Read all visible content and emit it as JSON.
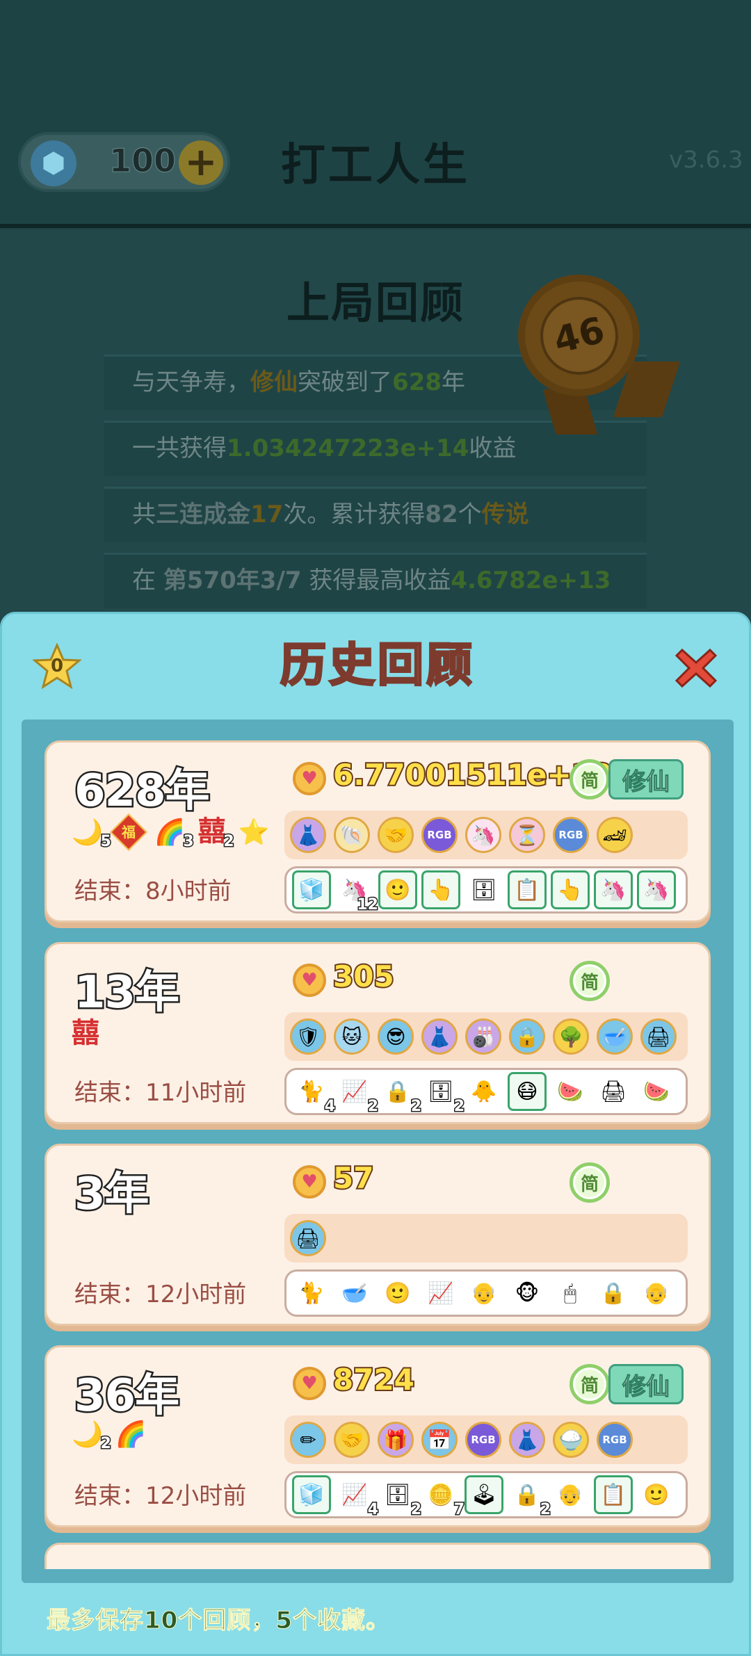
{
  "header": {
    "gems": "100",
    "title": "打工人生",
    "version": "v3.6.3"
  },
  "last_game": {
    "title": "上局回顾",
    "medal_number": "46",
    "lines": [
      {
        "parts": [
          "与天争寿，",
          "修仙",
          "突破到了",
          "628",
          "年"
        ]
      },
      {
        "parts": [
          "一共获得",
          "1.034247223e+14",
          "收益"
        ]
      },
      {
        "parts": [
          "共",
          "三连成金",
          "17",
          "次。累计获得",
          "82",
          "个",
          "传说"
        ]
      },
      {
        "parts": [
          "在 ",
          "第570年3/7",
          " 获得最高收益",
          "4.6782e+13"
        ]
      }
    ]
  },
  "dialog": {
    "title": "历史回顾",
    "star_count": "0",
    "footer_note": "最多保存10个回顾，5个收藏。",
    "simple_label": "简",
    "xiuxian_label": "修仙",
    "end_prefix": "结束：",
    "cards": [
      {
        "year": "628年",
        "score": "6.77001511e+13",
        "end_time": "8小时前",
        "xiuxian": true,
        "badges": [
          {
            "icon": "moon-icon",
            "glyph": "🌙",
            "count": "5"
          },
          {
            "icon": "fu-icon",
            "glyph": "福",
            "count": ""
          },
          {
            "icon": "rainbow-icon",
            "glyph": "🌈",
            "count": "3"
          },
          {
            "icon": "double-happiness-icon",
            "glyph": "囍",
            "count": "2"
          },
          {
            "icon": "star-icon",
            "glyph": "⭐",
            "count": ""
          }
        ],
        "row1": [
          {
            "icon": "skirt-icon",
            "glyph": "👗",
            "bg": "#c9a6e8"
          },
          {
            "icon": "shell-icon",
            "glyph": "🐚",
            "bg": "#f8e6a8"
          },
          {
            "icon": "handshake-icon",
            "glyph": "🤝",
            "bg": "#f6d24a"
          },
          {
            "icon": "rgb-icon",
            "glyph": "RGB",
            "bg": "#7a5ad8"
          },
          {
            "icon": "unicorn-icon",
            "glyph": "🦄",
            "bg": "#fbe4f0"
          },
          {
            "icon": "time-icon",
            "glyph": "⏳",
            "bg": "#f5c9d8"
          },
          {
            "icon": "rgb-icon",
            "glyph": "RGB",
            "bg": "#5a8ad8"
          },
          {
            "icon": "car-icon",
            "glyph": "🏎",
            "bg": "#f6d24a"
          }
        ],
        "row2": [
          {
            "icon": "fridge-icon",
            "glyph": "🧊",
            "count": "",
            "framed": true
          },
          {
            "icon": "unicorn-icon",
            "glyph": "🦄",
            "count": "12",
            "framed": false
          },
          {
            "icon": "face-icon",
            "glyph": "🙂",
            "count": "",
            "framed": true
          },
          {
            "icon": "pointer-icon",
            "glyph": "👆",
            "count": "",
            "framed": true
          },
          {
            "icon": "server-icon",
            "glyph": "🗄",
            "count": "",
            "framed": false
          },
          {
            "icon": "ctrl-c-icon",
            "glyph": "📋",
            "count": "",
            "framed": true
          },
          {
            "icon": "pointer-icon",
            "glyph": "👆",
            "count": "",
            "framed": true
          },
          {
            "icon": "unicorn-icon",
            "glyph": "🦄",
            "count": "",
            "framed": true
          },
          {
            "icon": "unicorn-icon",
            "glyph": "🦄",
            "count": "",
            "framed": true
          }
        ]
      },
      {
        "year": "13年",
        "score": "305",
        "end_time": "11小时前",
        "xiuxian": false,
        "badges": [
          {
            "icon": "double-happiness-icon",
            "glyph": "囍",
            "count": ""
          }
        ],
        "row1": [
          {
            "icon": "clock-shield-icon",
            "glyph": "🛡",
            "bg": "#7cc6e8"
          },
          {
            "icon": "cat-icon",
            "glyph": "🐱",
            "bg": "#a8d8f0"
          },
          {
            "icon": "sunglasses-icon",
            "glyph": "😎",
            "bg": "#7cc6e8"
          },
          {
            "icon": "skirt-icon",
            "glyph": "👗",
            "bg": "#c9a6e8"
          },
          {
            "icon": "bowling-icon",
            "glyph": "🎳",
            "bg": "#c9a6e8"
          },
          {
            "icon": "safe-icon",
            "glyph": "🔒",
            "bg": "#7cc6e8"
          },
          {
            "icon": "tree-icon",
            "glyph": "🌳",
            "bg": "#f6d24a"
          },
          {
            "icon": "bowl-icon",
            "glyph": "🥣",
            "bg": "#7cc6e8"
          },
          {
            "icon": "printer-icon",
            "glyph": "🖨",
            "bg": "#7cc6e8"
          }
        ],
        "row2": [
          {
            "icon": "cat-icon",
            "glyph": "🐈",
            "count": "4",
            "framed": false
          },
          {
            "icon": "chart-icon",
            "glyph": "📈",
            "count": "2",
            "framed": false
          },
          {
            "icon": "safe-icon",
            "glyph": "🔒",
            "count": "2",
            "framed": false
          },
          {
            "icon": "server-icon",
            "glyph": "🗄",
            "count": "2",
            "framed": false
          },
          {
            "icon": "chick-icon",
            "glyph": "🐥",
            "count": "",
            "framed": false
          },
          {
            "icon": "mask-face-icon",
            "glyph": "😷",
            "count": "",
            "framed": true
          },
          {
            "icon": "watermelon-icon",
            "glyph": "🍉",
            "count": "",
            "framed": false
          },
          {
            "icon": "printer-icon",
            "glyph": "🖨",
            "count": "",
            "framed": false
          },
          {
            "icon": "watermelon-icon",
            "glyph": "🍉",
            "count": "",
            "framed": false
          }
        ]
      },
      {
        "year": "3年",
        "score": "57",
        "end_time": "12小时前",
        "xiuxian": false,
        "badges": [],
        "row1": [
          {
            "icon": "printer-icon",
            "glyph": "🖨",
            "bg": "#7cc6e8"
          }
        ],
        "row2": [
          {
            "icon": "cat-icon",
            "glyph": "🐈",
            "count": "",
            "framed": false
          },
          {
            "icon": "bowl-icon",
            "glyph": "🥣",
            "count": "",
            "framed": false
          },
          {
            "icon": "face-icon",
            "glyph": "🙂",
            "count": "",
            "framed": false
          },
          {
            "icon": "chart-icon",
            "glyph": "📈",
            "count": "",
            "framed": false
          },
          {
            "icon": "old-man-icon",
            "glyph": "👴",
            "count": "",
            "framed": false
          },
          {
            "icon": "monkey-icon",
            "glyph": "🐵",
            "count": "",
            "framed": false
          },
          {
            "icon": "mouse-icon",
            "glyph": "🖱",
            "count": "",
            "framed": false
          },
          {
            "icon": "safe-icon",
            "glyph": "🔒",
            "count": "",
            "framed": false
          },
          {
            "icon": "old-man-icon",
            "glyph": "👴",
            "count": "",
            "framed": false
          }
        ]
      },
      {
        "year": "36年",
        "score": "8724",
        "end_time": "12小时前",
        "xiuxian": true,
        "badges": [
          {
            "icon": "moon-icon",
            "glyph": "🌙",
            "count": "2"
          },
          {
            "icon": "rainbow-icon",
            "glyph": "🌈",
            "count": ""
          }
        ],
        "row1": [
          {
            "icon": "pencil-icon",
            "glyph": "✏",
            "bg": "#7cc6e8"
          },
          {
            "icon": "handshake-icon",
            "glyph": "🤝",
            "bg": "#f6d24a"
          },
          {
            "icon": "present-icon",
            "glyph": "🎁",
            "bg": "#c9a6e8"
          },
          {
            "icon": "calendar-icon",
            "glyph": "📅",
            "bg": "#7cc6e8"
          },
          {
            "icon": "rgb-icon",
            "glyph": "RGB",
            "bg": "#7a5ad8"
          },
          {
            "icon": "skirt-icon",
            "glyph": "👗",
            "bg": "#c9a6e8"
          },
          {
            "icon": "rice-cooker-icon",
            "glyph": "🍚",
            "bg": "#f6d24a"
          },
          {
            "icon": "rgb-icon",
            "glyph": "RGB",
            "bg": "#5a8ad8"
          }
        ],
        "row2": [
          {
            "icon": "fridge-icon",
            "glyph": "🧊",
            "count": "",
            "framed": true
          },
          {
            "icon": "chart-icon",
            "glyph": "📈",
            "count": "4",
            "framed": false
          },
          {
            "icon": "server-icon",
            "glyph": "🗄",
            "count": "2",
            "framed": false
          },
          {
            "icon": "gold-bars-icon",
            "glyph": "🪙",
            "count": "7",
            "framed": false
          },
          {
            "icon": "arcade-icon",
            "glyph": "🕹",
            "count": "",
            "framed": true
          },
          {
            "icon": "safe-icon",
            "glyph": "🔒",
            "count": "2",
            "framed": false
          },
          {
            "icon": "old-man-icon",
            "glyph": "👴",
            "count": "",
            "framed": false
          },
          {
            "icon": "ctrl-c-icon",
            "glyph": "📋",
            "count": "",
            "framed": true
          },
          {
            "icon": "face-icon",
            "glyph": "🙂",
            "count": "",
            "framed": false
          }
        ]
      }
    ]
  }
}
